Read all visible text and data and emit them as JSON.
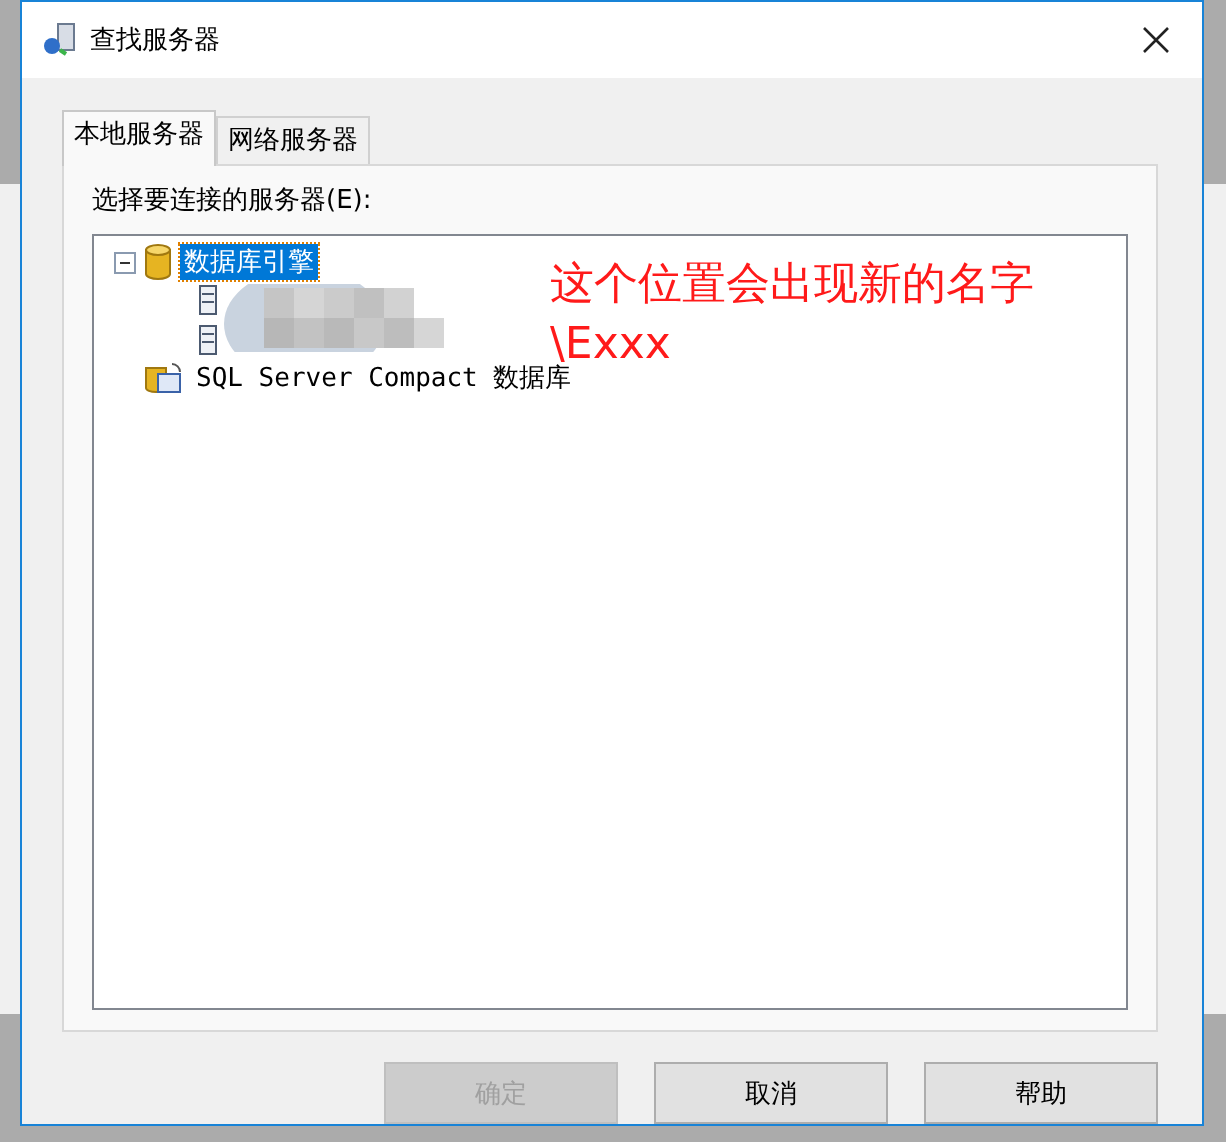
{
  "window": {
    "title": "查找服务器"
  },
  "tabs": [
    {
      "label": "本地服务器",
      "selected": true
    },
    {
      "label": "网络服务器",
      "selected": false
    }
  ],
  "prompt": "选择要连接的服务器(E):",
  "tree": [
    {
      "label": "数据库引擎",
      "kind": "database",
      "expanded": true,
      "selected": true,
      "children": [
        {
          "kind": "server"
        },
        {
          "kind": "server"
        }
      ]
    },
    {
      "label": "SQL Server Compact 数据库",
      "kind": "compact",
      "selected": false
    }
  ],
  "annotation": [
    "这个位置会出现新的名字",
    "\\Exxx"
  ],
  "buttons": [
    {
      "label": "确定",
      "disabled": true
    },
    {
      "label": "取消",
      "disabled": false
    },
    {
      "label": "帮助",
      "disabled": false
    }
  ]
}
